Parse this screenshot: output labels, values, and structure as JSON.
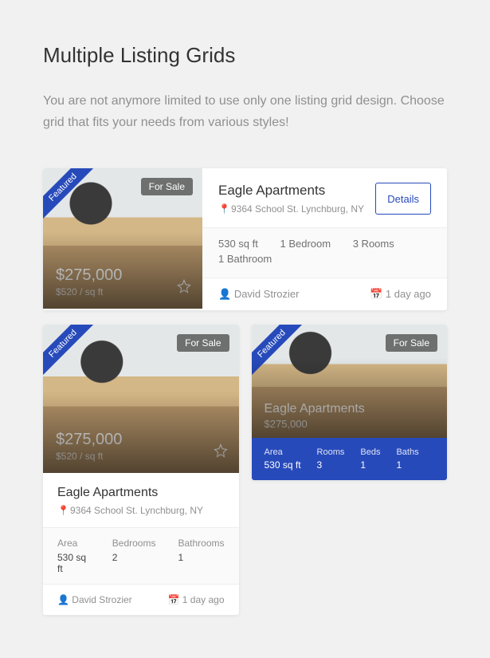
{
  "page": {
    "heading": "Multiple Listing Grids",
    "intro": "You are not anymore limited to use only one listing grid design. Choose grid that fits your needs from various styles!"
  },
  "common": {
    "featured": "Featured",
    "for_sale": "For Sale"
  },
  "cardA": {
    "price": "$275,000",
    "ppsf": "$520 / sq ft",
    "title": "Eagle Apartments",
    "address": "9364 School St. Lynchburg, NY",
    "details_label": "Details",
    "specs": {
      "area": "530 sq ft",
      "bedrooms": "1 Bedroom",
      "rooms": "3 Rooms",
      "bathrooms": "1 Bathroom"
    },
    "agent": "David Strozier",
    "posted": "1 day ago"
  },
  "cardB": {
    "price": "$275,000",
    "ppsf": "$520 / sq ft",
    "title": "Eagle Apartments",
    "address": "9364 School St. Lynchburg, NY",
    "stats": {
      "area": {
        "label": "Area",
        "value": "530 sq ft"
      },
      "bedrooms": {
        "label": "Bedrooms",
        "value": "2"
      },
      "bathrooms": {
        "label": "Bathrooms",
        "value": "1"
      }
    },
    "agent": "David Strozier",
    "posted": "1 day ago"
  },
  "cardC": {
    "title": "Eagle Apartments",
    "price": "$275,000",
    "stats": {
      "area": {
        "label": "Area",
        "value": "530 sq ft"
      },
      "rooms": {
        "label": "Rooms",
        "value": "3"
      },
      "beds": {
        "label": "Beds",
        "value": "1"
      },
      "baths": {
        "label": "Baths",
        "value": "1"
      }
    }
  }
}
